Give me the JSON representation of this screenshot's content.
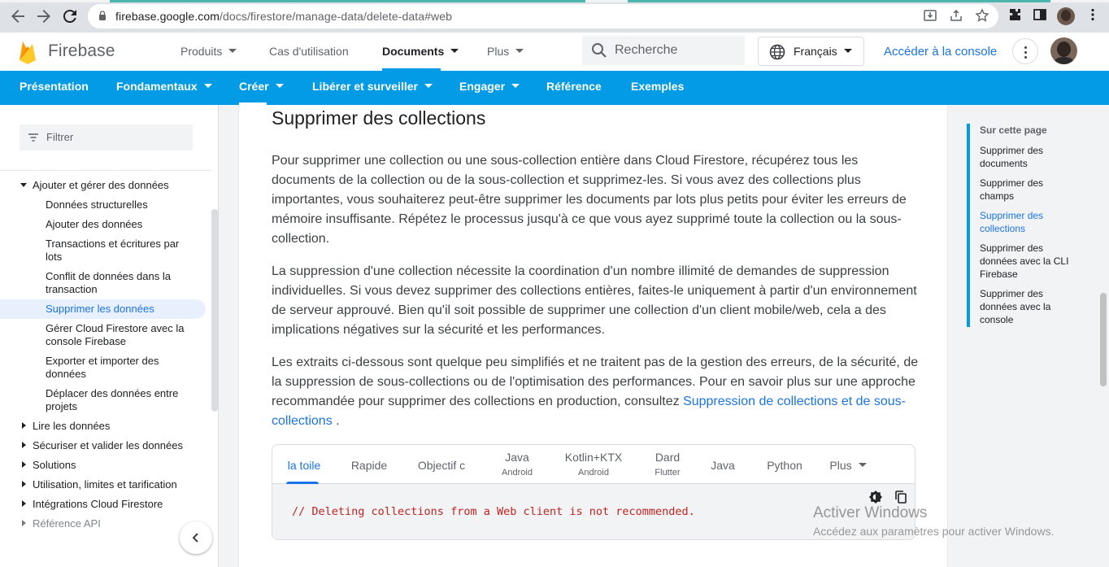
{
  "browser": {
    "url_host": "firebase.google.com",
    "url_path": "/docs/firestore/manage-data/delete-data#web"
  },
  "header": {
    "logo_text": "Firebase",
    "nav": [
      "Produits",
      "Cas d'utilisation",
      "Documents",
      "Plus"
    ],
    "active_nav": "Documents",
    "search_placeholder": "Recherche",
    "language": "Français",
    "console_link": "Accéder à la console"
  },
  "subnav": {
    "items": [
      "Présentation",
      "Fondamentaux",
      "Créer",
      "Libérer et surveiller",
      "Engager",
      "Référence",
      "Exemples"
    ],
    "active": "Créer"
  },
  "sidebar": {
    "filter_placeholder": "Filtrer",
    "section": "Ajouter et gérer des données",
    "children": [
      "Données structurelles",
      "Ajouter des données",
      "Transactions et écritures par lots",
      "Conflit de données dans la transaction",
      "Supprimer les données",
      "Gérer Cloud Firestore avec la console Firebase",
      "Exporter et importer des données",
      "Déplacer des données entre projets"
    ],
    "active_child": "Supprimer les données",
    "top_items": [
      "Lire les données",
      "Sécuriser et valider les données",
      "Solutions",
      "Utilisation, limites et tarification",
      "Intégrations Cloud Firestore",
      "Référence API"
    ]
  },
  "content": {
    "heading": "Supprimer des collections",
    "para1": "Pour supprimer une collection ou une sous-collection entière dans Cloud Firestore, récupérez tous les documents de la collection ou de la sous-collection et supprimez-les. Si vous avez des collections plus importantes, vous souhaiterez peut-être supprimer les documents par lots plus petits pour éviter les erreurs de mémoire insuffisante. Répétez le processus jusqu'à ce que vous ayez supprimé toute la collection ou la sous-collection.",
    "para2": "La suppression d'une collection nécessite la coordination d'un nombre illimité de demandes de suppression individuelles. Si vous devez supprimer des collections entières, faites-le uniquement à partir d'un environnement de serveur approuvé. Bien qu'il soit possible de supprimer une collection d'un client mobile/web, cela a des implications négatives sur la sécurité et les performances.",
    "para3_text": "Les extraits ci-dessous sont quelque peu simplifiés et ne traitent pas de la gestion des erreurs, de la sécurité, de la suppression de sous-collections ou de l'optimisation des performances. Pour en savoir plus sur une approche recommandée pour supprimer des collections en production, consultez",
    "para3_link": "Suppression de collections et de sous-collections",
    "para3_end": ".",
    "code_tabs": [
      {
        "label": "la toile",
        "sub": ""
      },
      {
        "label": "Rapide",
        "sub": ""
      },
      {
        "label": "Objectif c",
        "sub": ""
      },
      {
        "label": "Java",
        "sub": "Android"
      },
      {
        "label": "Kotlin+KTX",
        "sub": "Android"
      },
      {
        "label": "Dard",
        "sub": "Flutter"
      },
      {
        "label": "Java",
        "sub": ""
      },
      {
        "label": "Python",
        "sub": ""
      },
      {
        "label": "Plus",
        "sub": ""
      }
    ],
    "active_code_tab": "la toile",
    "code": "// Deleting collections from a Web client is not recommended."
  },
  "toc": {
    "title": "Sur cette page",
    "items": [
      "Supprimer des documents",
      "Supprimer des champs",
      "Supprimer des collections",
      "Supprimer des données avec la CLI Firebase",
      "Supprimer des données avec la console"
    ],
    "active": "Supprimer des collections"
  },
  "watermark": {
    "line1": "Activer Windows",
    "line2": "Accédez aux paramètres pour activer Windows."
  },
  "colors": {
    "accent_blue": "#039be5",
    "link_blue": "#1a73e8",
    "code_red": "#c5221f"
  }
}
